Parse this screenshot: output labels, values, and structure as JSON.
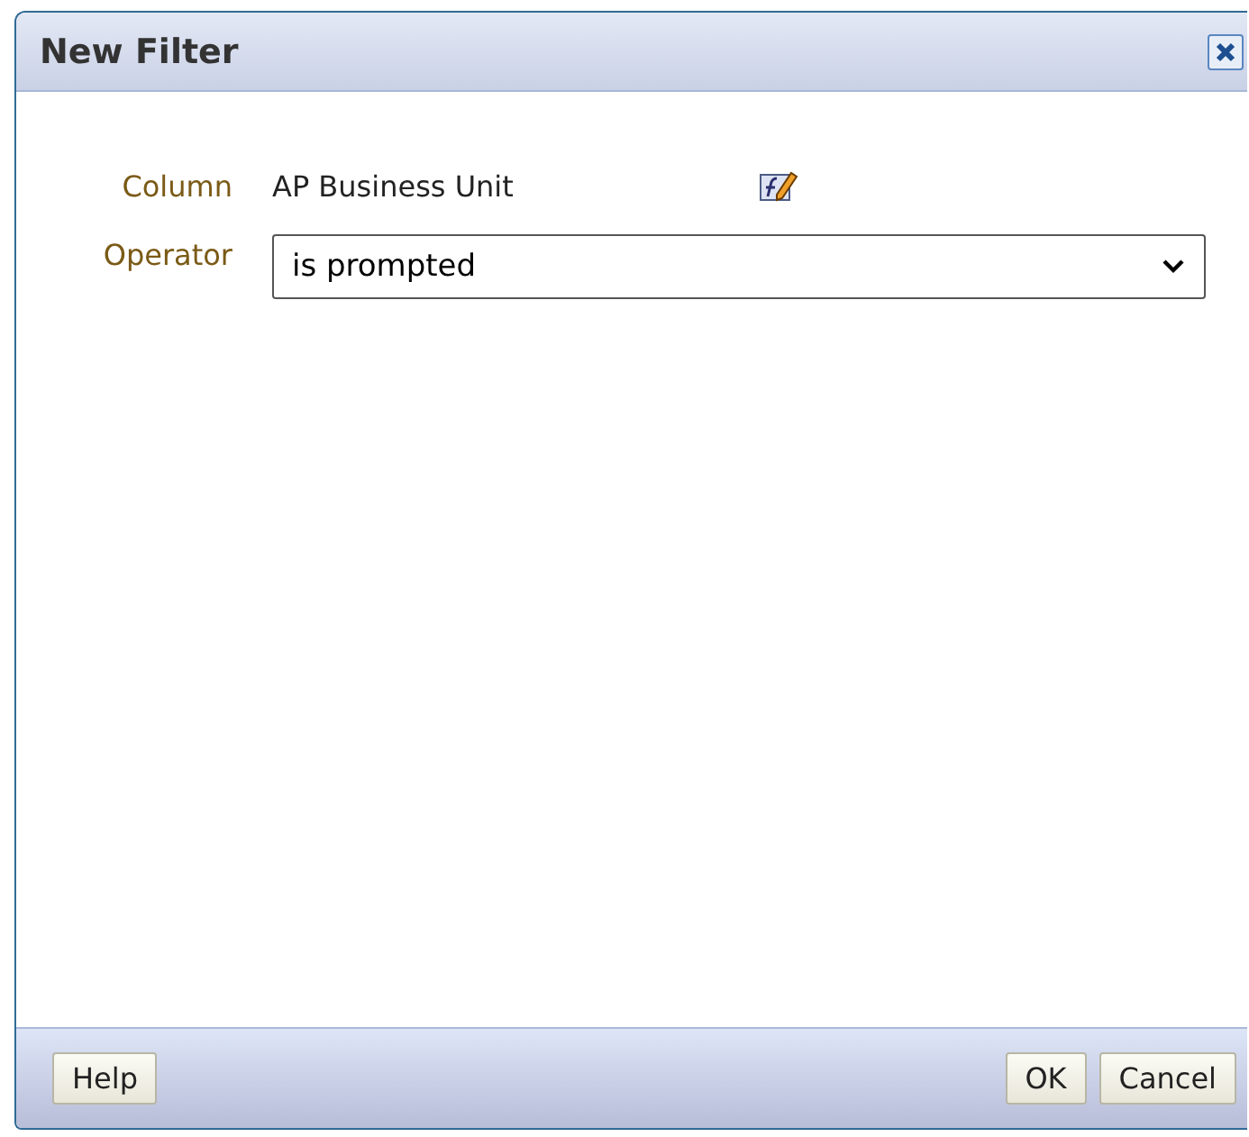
{
  "window": {
    "title": "New Filter"
  },
  "fields": [
    {
      "kind": "text",
      "label": "Column",
      "value": "AP Business Unit"
    },
    {
      "kind": "select",
      "label": "Operator",
      "value": "is prompted"
    }
  ],
  "buttons_left": [
    "Help"
  ],
  "buttons_right": [
    "OK",
    "Cancel"
  ]
}
